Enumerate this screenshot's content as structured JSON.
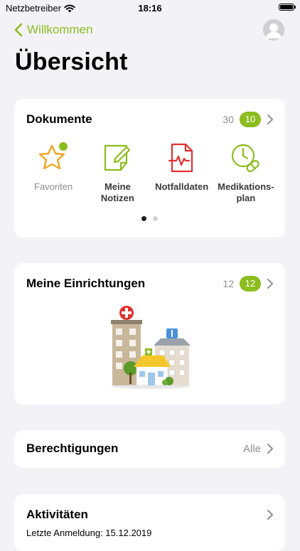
{
  "status_bar": {
    "carrier": "Netzbetreiber",
    "time": "18:16",
    "battery_level": 1.0
  },
  "nav": {
    "back_label": "Willkommen"
  },
  "page": {
    "title": "Übersicht"
  },
  "documents": {
    "title": "Dokumente",
    "total_count": "30",
    "badge_count": "10",
    "items": [
      {
        "label": "Favoriten",
        "icon": "star-icon"
      },
      {
        "label": "Meine Notizen",
        "icon": "notes-icon"
      },
      {
        "label": "Notfalldaten",
        "icon": "emergency-document-icon"
      },
      {
        "label": "Medikations-plan",
        "icon": "medication-plan-icon"
      }
    ],
    "page_indicator": {
      "pages": 2,
      "current": 1
    }
  },
  "facilities": {
    "title": "Meine Einrichtungen",
    "total_count": "12",
    "badge_count": "12"
  },
  "permissions": {
    "title": "Berechtigungen",
    "value": "Alle"
  },
  "activities": {
    "title": "Aktivitäten",
    "last_login": "Letzte Anmeldung: 15.12.2019"
  },
  "colors": {
    "accent": "#8cbd1e",
    "red": "#e0312f",
    "background": "#f2f2f7"
  }
}
